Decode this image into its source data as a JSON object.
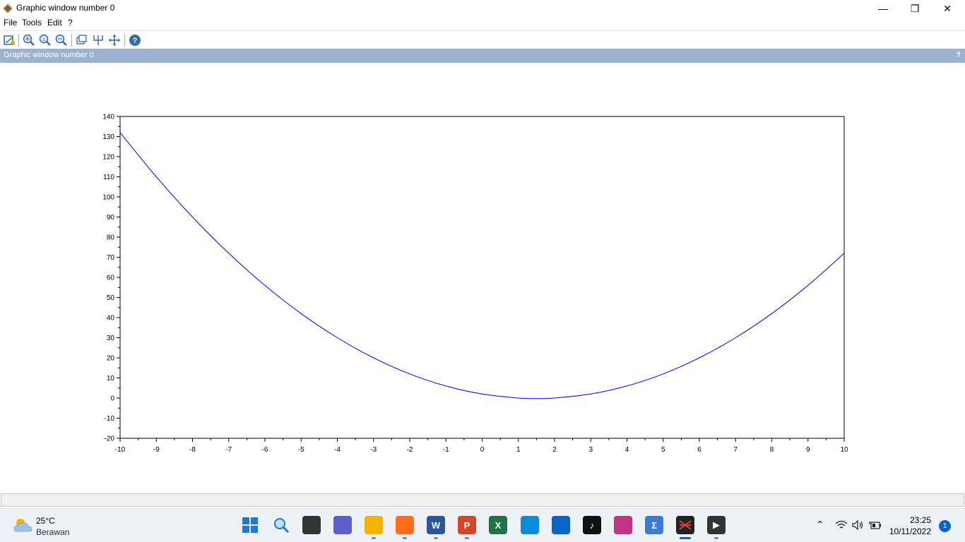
{
  "window": {
    "title": "Graphic window number 0",
    "minimize": "—",
    "maximize": "❐",
    "close": "✕"
  },
  "menu": [
    "File",
    "Tools",
    "Edit",
    "?"
  ],
  "toolbar_icons": [
    "rotate-icon",
    "zoom-icon",
    "zoom-fit-icon",
    "zoom-reset-icon",
    "datatip-icon",
    "edit-axes-icon",
    "pan-icon",
    "help-icon"
  ],
  "dock": {
    "title": "Graphic window number 0",
    "help": "?"
  },
  "chart_data": {
    "type": "line",
    "title": "",
    "xlabel": "",
    "ylabel": "",
    "xlim": [
      -10,
      10
    ],
    "ylim": [
      -20,
      140
    ],
    "x_ticks": [
      "-10",
      "-9",
      "-8",
      "-7",
      "-6",
      "-5",
      "-4",
      "-3",
      "-2",
      "-1",
      "0",
      "1",
      "2",
      "3",
      "4",
      "5",
      "6",
      "7",
      "8",
      "9",
      "10"
    ],
    "y_ticks": [
      "-20",
      "-10",
      "0",
      "10",
      "20",
      "30",
      "40",
      "50",
      "60",
      "70",
      "80",
      "90",
      "100",
      "110",
      "120",
      "130",
      "140"
    ],
    "grid": false,
    "series": [
      {
        "color": "#0000ff",
        "x": [
          -10,
          -9,
          -8,
          -7,
          -6,
          -5,
          -4,
          -3,
          -2,
          -1,
          0,
          1,
          1.5,
          2,
          3,
          4,
          5,
          6,
          7,
          8,
          9,
          10
        ],
        "y": [
          132,
          110,
          90,
          72,
          56,
          42,
          30,
          20,
          12,
          6,
          2,
          0,
          -0.25,
          0,
          2,
          6,
          12,
          20,
          30,
          42,
          56,
          72
        ]
      }
    ]
  },
  "taskbar": {
    "weather_temp": "25°C",
    "weather_desc": "Berawan",
    "apps": [
      {
        "name": "windows-start-icon",
        "label": "",
        "color": "#1e78d7"
      },
      {
        "name": "search-icon",
        "label": "",
        "color": "#1e90ff"
      },
      {
        "name": "task-view-icon",
        "label": "",
        "color": "#333333"
      },
      {
        "name": "chat-icon",
        "label": "",
        "color": "#5b5fc7"
      },
      {
        "name": "file-explorer-icon",
        "label": "",
        "color": "#f2b400"
      },
      {
        "name": "firefox-icon",
        "label": "",
        "color": "#ff6d1b"
      },
      {
        "name": "word-icon",
        "label": "W",
        "color": "#2b579a"
      },
      {
        "name": "powerpoint-icon",
        "label": "P",
        "color": "#d24726"
      },
      {
        "name": "excel-icon",
        "label": "X",
        "color": "#217346"
      },
      {
        "name": "edge-icon",
        "label": "",
        "color": "#0c8bd8"
      },
      {
        "name": "mail-icon",
        "label": "",
        "color": "#0a64c8"
      },
      {
        "name": "tiktok-icon",
        "label": "♪",
        "color": "#111111"
      },
      {
        "name": "instagram-icon",
        "label": "",
        "color": "#c13584"
      },
      {
        "name": "math-icon",
        "label": "Σ",
        "color": "#3a7bd5"
      },
      {
        "name": "scilab-icon",
        "label": "",
        "color": "#222222"
      },
      {
        "name": "media-player-icon",
        "label": "▶",
        "color": "#333333"
      }
    ],
    "clock_time": "23:25",
    "clock_date": "10/11/2022",
    "notifications": "1"
  }
}
